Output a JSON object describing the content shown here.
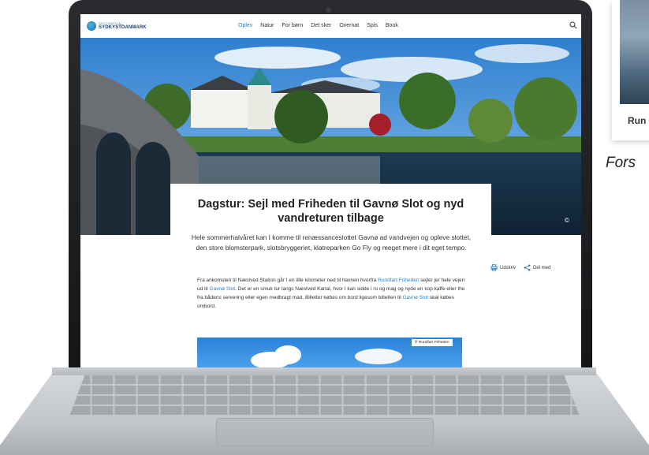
{
  "background": {
    "card_label": "Run",
    "caption": "Fors"
  },
  "site": {
    "logo": {
      "line1": "DESTINATION",
      "line2": "SYDKYSTDANMARK"
    },
    "nav": [
      "Oplev",
      "Natur",
      "For børn",
      "Det sker",
      "Overnat",
      "Spis",
      "Book"
    ],
    "active_nav": "Oplev",
    "hero_copyright": "©",
    "article": {
      "title": "Dagstur: Sejl med Friheden til Gavnø Slot og nyd vandreturen tilbage",
      "lead": "Hele sommerhalvåret kan I komme til renæssanceslottet Gavnø ad vandvejen og opleve slottet, den store blomsterpark, slotsbryggeriet, klatreparken Go Fly og meget mere i dit eget tempo.",
      "body_1": "Fra ankomsten til Næstved Station går I en lille kilometer ned til havnen hvorfra",
      "link_1": "Rundfart Friheden",
      "body_2": "sejler jer hele vejen ud til",
      "link_2": "Gavnø Slot",
      "body_3": ". Det er en smuk tur langs Næstved Kanal, hvor I kan sidde i ro og mag og nyde en kop kaffe eller the fra bådens servering eller egen medbragt mad. Billetter købes om bord ligesom billetten til",
      "link_3": "Gavnø Slot",
      "body_4": "skal købes ombord.",
      "image_tag": "Rundfart Friheden"
    },
    "tools": {
      "print": "Udskriv",
      "share": "Del med"
    }
  },
  "colors": {
    "link": "#2a7fc1",
    "title": "#222222"
  }
}
